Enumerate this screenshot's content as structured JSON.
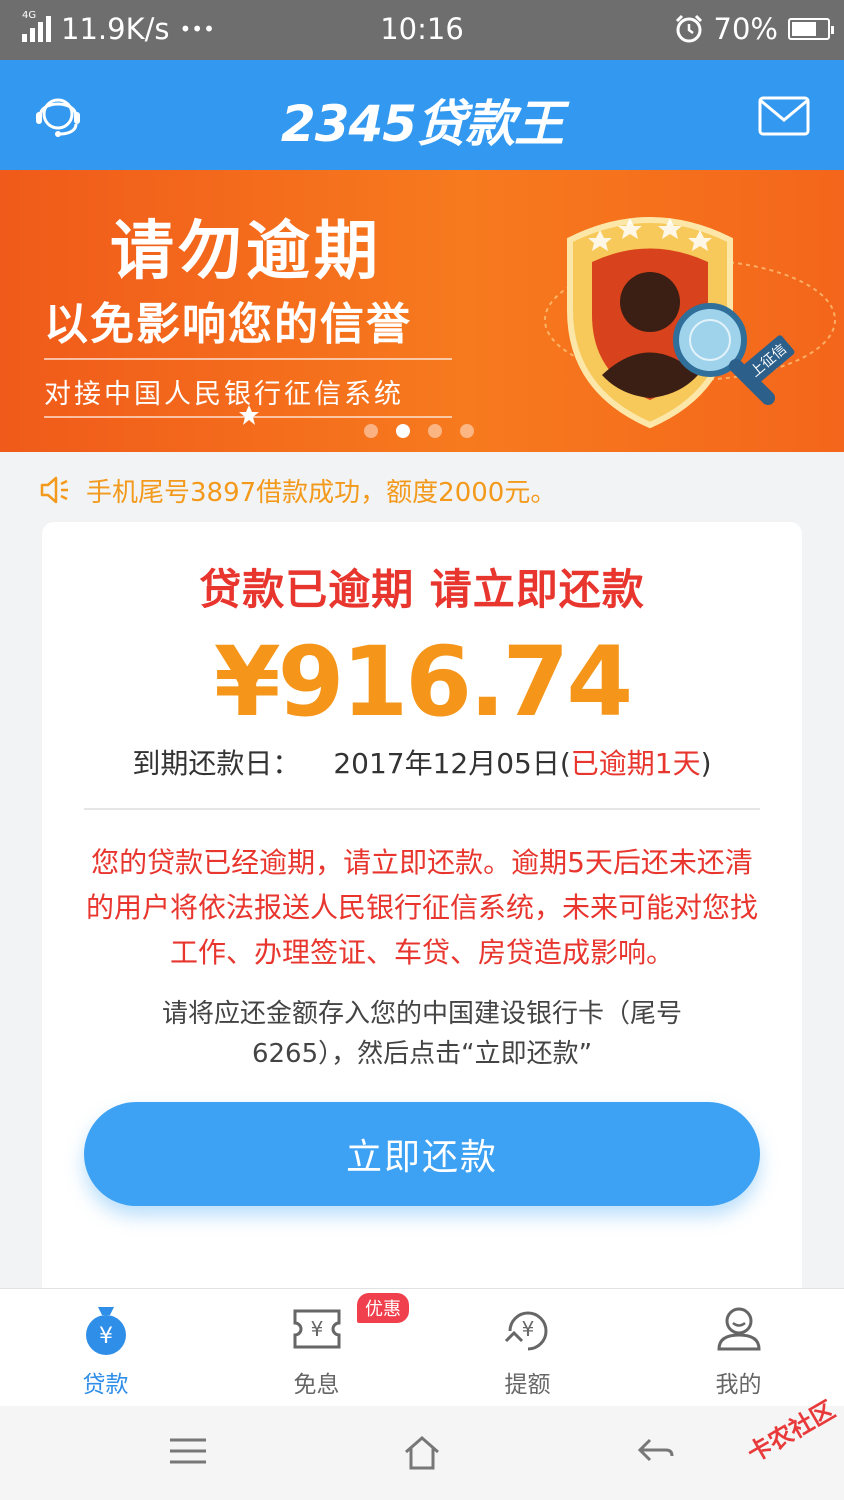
{
  "status_bar": {
    "network": "4G",
    "speed": "11.9K/s",
    "more": "•••",
    "time": "10:16",
    "battery": "70%",
    "battery_level": 0.7
  },
  "header": {
    "title": "2345贷款王",
    "left_icon": "customer-service-icon",
    "right_icon": "mail-icon",
    "color": "#3399f0"
  },
  "banner": {
    "line1": "请勿逾期",
    "line2": "以免影响您的信誉",
    "line3": "对接中国人民银行征信系统",
    "badge_tag": "上征信",
    "slides": 4,
    "active_slide": 2
  },
  "notice": {
    "text": "手机尾号3897借款成功，额度2000元。"
  },
  "loan": {
    "title": "贷款已逾期 请立即还款",
    "amount": "¥916.74",
    "due_label": "到期还款日：",
    "due_date": "2017年12月05日(",
    "overdue": "已逾期1天",
    "due_close": ")",
    "warning": "您的贷款已经逾期，请立即还款。逾期5天后还未还清的用户将依法报送人民银行征信系统，未来可能对您找工作、办理签证、车贷、房贷造成影响。",
    "instruction": "请将应还金额存入您的中国建设银行卡（尾号6265），然后点击“立即还款”",
    "pay_button": "立即还款",
    "accent_red": "#e8352e",
    "amount_color": "#f5961b"
  },
  "tabs": [
    {
      "label": "贷款",
      "icon": "money-bag-icon",
      "active": true
    },
    {
      "label": "免息",
      "icon": "ticket-icon",
      "active": false,
      "badge": "优惠"
    },
    {
      "label": "提额",
      "icon": "raise-limit-icon",
      "active": false
    },
    {
      "label": "我的",
      "icon": "user-icon",
      "active": false
    }
  ],
  "watermark": "卡农社区"
}
